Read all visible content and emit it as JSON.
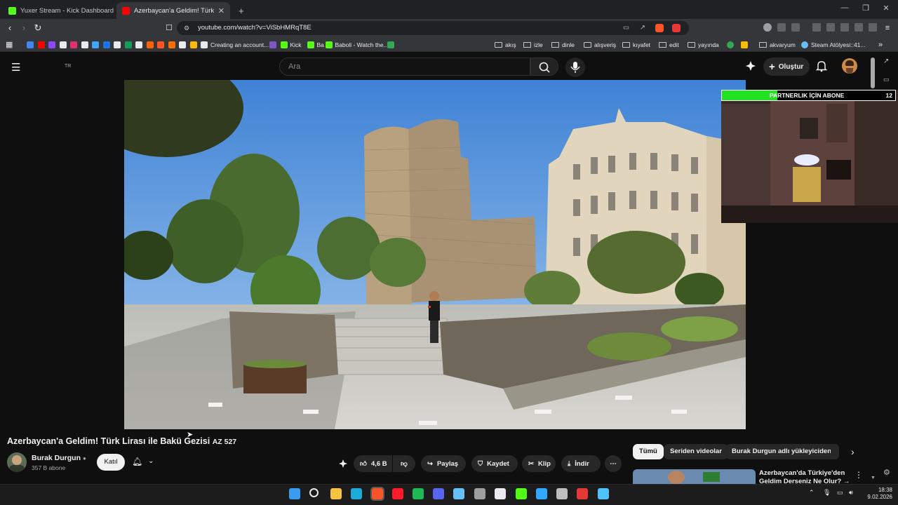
{
  "browser": {
    "tabs": [
      {
        "label": "Yuxer Stream - Kick Dashboard",
        "active": false,
        "favicon_color": "#53fc18"
      },
      {
        "label": "Azerbaycan'a Geldim! Türk Lirası",
        "active": true,
        "favicon_color": "#ff0000"
      }
    ],
    "new_tab": "+",
    "url": "youtube.com/watch?v=ViSbHMRqT8E",
    "bookmarks": [
      {
        "label": "",
        "icon": "google-icon",
        "color": "#4285f4"
      },
      {
        "label": "",
        "icon": "youtube-icon",
        "color": "#ff0000"
      },
      {
        "label": "",
        "icon": "twitch-icon",
        "color": "#9146ff"
      },
      {
        "label": "",
        "icon": "x-icon",
        "color": "#e8eaed"
      },
      {
        "label": "",
        "icon": "instagram-icon",
        "color": "#e1306c"
      },
      {
        "label": "",
        "icon": "github-icon",
        "color": "#e8eaed"
      },
      {
        "label": "",
        "icon": "cloud-icon",
        "color": "#3ea6ff"
      },
      {
        "label": "",
        "icon": "play-icon",
        "color": "#1a73e8"
      },
      {
        "label": "",
        "icon": "w-icon",
        "color": "#e8eaed"
      },
      {
        "label": "",
        "icon": "leaf-icon",
        "color": "#0f9d58"
      },
      {
        "label": "",
        "icon": "tiktok-icon",
        "color": "#e8eaed"
      },
      {
        "label": "",
        "icon": "hb-icon",
        "color": "#ff6000"
      },
      {
        "label": "",
        "icon": "circle-icon",
        "color": "#ff5722"
      },
      {
        "label": "",
        "icon": "m-icon",
        "color": "#ff6d00"
      },
      {
        "label": "",
        "icon": "a-icon",
        "color": "#e8eaed"
      },
      {
        "label": "",
        "icon": "note-icon",
        "color": "#fbbc04"
      },
      {
        "label": "Creating an account...",
        "icon": "pen-icon",
        "color": "#e8eaed"
      },
      {
        "label": "",
        "icon": "swirl-icon",
        "color": "#7e57c2"
      },
      {
        "label": "Kick",
        "icon": "kick-icon",
        "color": "#53fc18"
      },
      {
        "label": "Ba",
        "icon": "kick-icon",
        "color": "#53fc18"
      },
      {
        "label": "Baboli - Watch the...",
        "icon": "kick-icon",
        "color": "#53fc18"
      },
      {
        "label": "",
        "icon": "dot-icon",
        "color": "#34a853"
      }
    ],
    "folders": [
      "akış",
      "izle",
      "dinle",
      "alışveriş",
      "kıyafet",
      "edit",
      "yayında"
    ],
    "bookmarks_tail": [
      {
        "label": "akvaryum",
        "icon": "folder-icon"
      },
      {
        "label": "Steam Atölyesi::41...",
        "icon": "steam-icon"
      }
    ]
  },
  "youtube": {
    "country_code": "TR",
    "search_placeholder": "Ara",
    "create_label": "Oluştur",
    "video_title": "Azerbaycan'a Geldim! Türk Lirası ile Bakü Gezisi",
    "video_title_suffix": "AZ 527",
    "channel_name": "Burak Durgun",
    "subscribers": "357 B abone",
    "join_label": "Katıl",
    "likes": "4,6 B",
    "share_label": "Paylaş",
    "save_label": "Kaydet",
    "clip_label": "Klip",
    "download_label": "İndir",
    "chips": [
      "Tümü",
      "Seriden videolar",
      "Burak Durgun adlı yükleyiciden"
    ],
    "recommended_title": "Azerbaycan'da Türkiye'den Geldim Derseniz Ne Olur? →"
  },
  "overlay": {
    "goal_label": "PARTNERLIK İÇİN ABONE",
    "goal_count": "12",
    "goal_progress": 0.32,
    "goal_color": "#22e322"
  },
  "taskbar": {
    "time": "18:38",
    "date": "9.02.2026",
    "icons": [
      {
        "name": "windows-start-icon",
        "color": "#3a9bf0"
      },
      {
        "name": "search-icon",
        "color": "#e8eaed"
      },
      {
        "name": "file-explorer-icon",
        "color": "#f5c242"
      },
      {
        "name": "edge-icon",
        "color": "#1fa9d8"
      },
      {
        "name": "brave-icon",
        "color": "#fb542b"
      },
      {
        "name": "opera-icon",
        "color": "#ff1b2d"
      },
      {
        "name": "spotify-icon",
        "color": "#1db954"
      },
      {
        "name": "discord-icon",
        "color": "#5865f2"
      },
      {
        "name": "steam-icon",
        "color": "#66c0f4"
      },
      {
        "name": "calculator-icon",
        "color": "#9e9e9e"
      },
      {
        "name": "obs-icon",
        "color": "#e8eaed"
      },
      {
        "name": "kick-icon",
        "color": "#53fc18"
      },
      {
        "name": "photoshop-icon",
        "color": "#31a8ff"
      },
      {
        "name": "settings-icon",
        "color": "#bdbdbd"
      },
      {
        "name": "capture-icon",
        "color": "#e53935"
      },
      {
        "name": "network-app-icon",
        "color": "#4fc3f7"
      }
    ]
  }
}
